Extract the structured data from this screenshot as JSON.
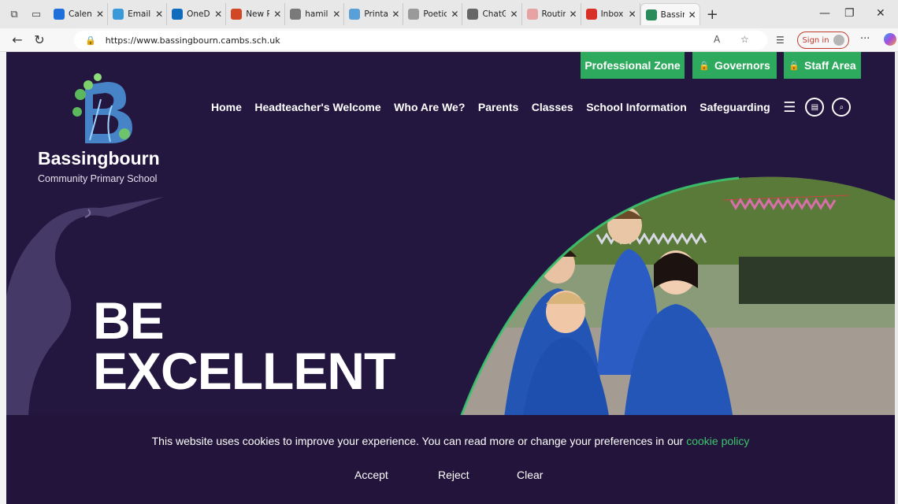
{
  "browser": {
    "tabs": [
      {
        "label": "Calend",
        "color": "#1e6fd9"
      },
      {
        "label": "Email",
        "color": "#3a9ad9"
      },
      {
        "label": "OneD",
        "color": "#0f6cbd"
      },
      {
        "label": "New P",
        "color": "#d24726"
      },
      {
        "label": "hamil",
        "color": "#7a7a7a"
      },
      {
        "label": "Printa",
        "color": "#5aa0d8"
      },
      {
        "label": "Poetic",
        "color": "#9a9a9a"
      },
      {
        "label": "ChatG",
        "color": "#666666"
      },
      {
        "label": "Routin",
        "color": "#e7a3a3"
      },
      {
        "label": "Inbox",
        "color": "#d93025"
      },
      {
        "label": "Bassin",
        "color": "#2b8a5a"
      }
    ],
    "url": "https://www.bassingbourn.cambs.sch.uk",
    "sign_in": "Sign in"
  },
  "site": {
    "top_buttons": {
      "professional": "Professional Zone",
      "governors": "Governors",
      "staff": "Staff Area"
    },
    "brand_name": "Bassingbourn",
    "brand_sub": "Community Primary School",
    "nav": [
      "Home",
      "Headteacher's Welcome",
      "Who Are We?",
      "Parents",
      "Classes",
      "School Information",
      "Safeguarding"
    ],
    "hero_line1": "BE",
    "hero_line2": "EXCELLENT"
  },
  "cookie": {
    "message": "This website uses cookies to improve your experience. You can read more or change your preferences in our",
    "link": "cookie policy",
    "accept": "Accept",
    "reject": "Reject",
    "clear": "Clear"
  },
  "colors": {
    "page_bg": "#23163f",
    "accent_green": "#2eaa5e",
    "link_green": "#3cc46e"
  }
}
